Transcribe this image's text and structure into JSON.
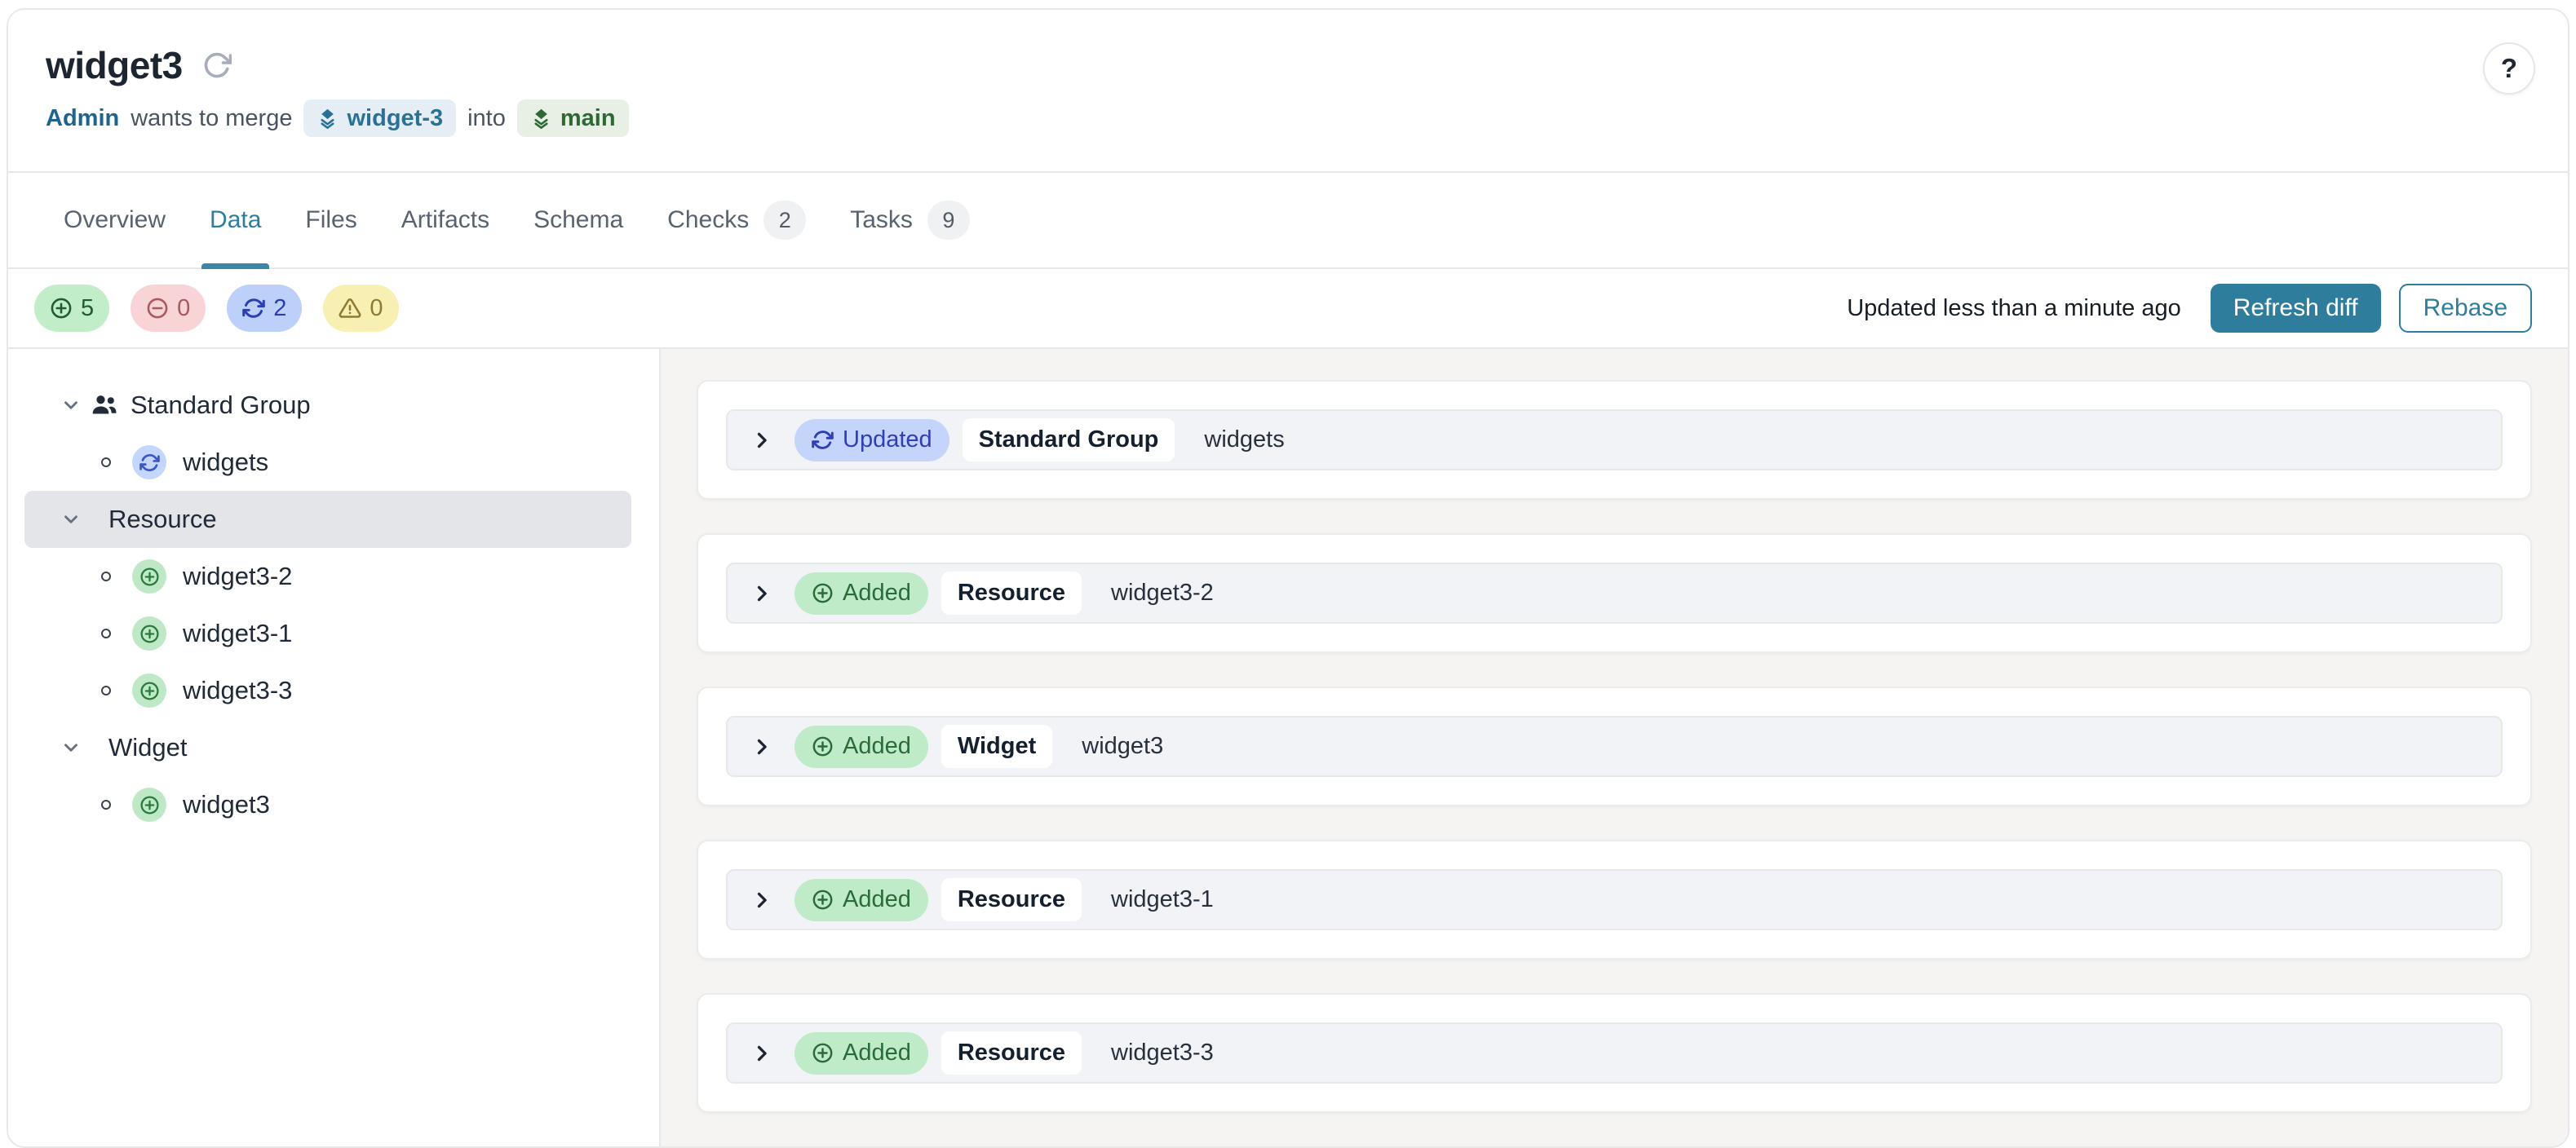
{
  "colors": {
    "accent_teal": "#2F7D9C",
    "added_green_bg": "#C0EBC8",
    "added_green_text": "#2B6B3A",
    "removed_red_bg": "#F8D4D7",
    "removed_red_text": "#A85A60",
    "updated_blue_bg": "#C5D4FB",
    "updated_blue_text": "#2F3FB4",
    "warning_yellow_bg": "#F8EFB3",
    "warning_yellow_text": "#8F7A33",
    "source_branch_text": "#2A7295",
    "target_branch_text": "#2D6A33",
    "selected_row_bg": "#E4E5E9",
    "main_background": "#F5F4F2"
  },
  "header": {
    "title": "widget3",
    "author": "Admin",
    "merge_text": "wants to merge",
    "source_branch": "widget-3",
    "into_text": "into",
    "target_branch": "main",
    "help_label": "?"
  },
  "tabs": [
    {
      "label": "Overview"
    },
    {
      "label": "Data",
      "active": true
    },
    {
      "label": "Files"
    },
    {
      "label": "Artifacts"
    },
    {
      "label": "Schema"
    },
    {
      "label": "Checks",
      "badge": "2"
    },
    {
      "label": "Tasks",
      "badge": "9"
    }
  ],
  "stats_bar": {
    "added_count": "5",
    "removed_count": "0",
    "updated_count": "2",
    "warning_count": "0",
    "updated_ago": "Updated less than a minute ago",
    "refresh_button": "Refresh diff",
    "rebase_button": "Rebase"
  },
  "sidebar": {
    "groups": [
      {
        "label": "Standard Group",
        "children": [
          {
            "label": "widgets",
            "status": "updated"
          }
        ]
      },
      {
        "label": "Resource",
        "selected": true,
        "children": [
          {
            "label": "widget3-2",
            "status": "added"
          },
          {
            "label": "widget3-1",
            "status": "added"
          },
          {
            "label": "widget3-3",
            "status": "added"
          }
        ]
      },
      {
        "label": "Widget",
        "children": [
          {
            "label": "widget3",
            "status": "added"
          }
        ]
      }
    ]
  },
  "diff_rows": [
    {
      "status": "Updated",
      "type": "Standard Group",
      "name": "widgets"
    },
    {
      "status": "Added",
      "type": "Resource",
      "name": "widget3-2"
    },
    {
      "status": "Added",
      "type": "Widget",
      "name": "widget3"
    },
    {
      "status": "Added",
      "type": "Resource",
      "name": "widget3-1"
    },
    {
      "status": "Added",
      "type": "Resource",
      "name": "widget3-3"
    }
  ]
}
